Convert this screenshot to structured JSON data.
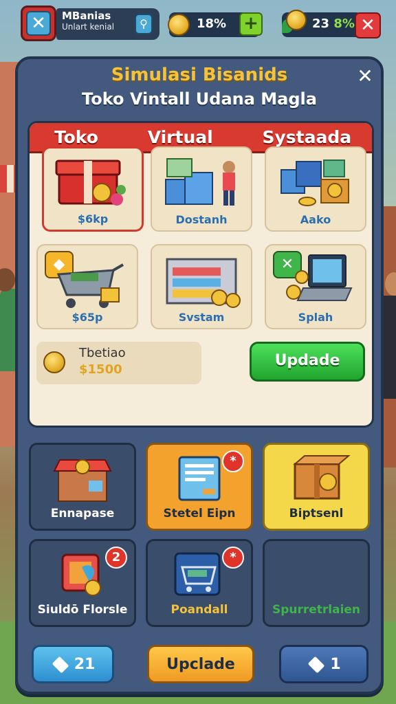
{
  "hud": {
    "profile_name": "MBanias",
    "profile_sub": "Unlart kenial",
    "coins": "18%",
    "gems_main": "23",
    "gems_accent": "8%",
    "icons": [
      "close-icon",
      "location-pin-icon",
      "coin-icon",
      "plus-icon",
      "coin-stack-icon",
      "close-icon"
    ]
  },
  "panel": {
    "title": "Simulasi Bisanids",
    "subtitle": "Toko Vintall Udana Magla",
    "tabs": [
      "Toko",
      "Virtual",
      "Systaada"
    ],
    "items": [
      {
        "label": "$6kp",
        "icon": "gift-box-icon"
      },
      {
        "label": "Dostanh",
        "icon": "shop-counter-icon"
      },
      {
        "label": "Aako",
        "icon": "crates-icon"
      },
      {
        "label": "$65p",
        "icon": "shopping-cart-icon"
      },
      {
        "label": "Svstam",
        "icon": "shelf-icon"
      },
      {
        "label": "Splah",
        "icon": "laptop-icon"
      }
    ],
    "balance_label": "Tbetiao",
    "balance_value": "$1500",
    "update_button": "Updade"
  },
  "tiles": [
    {
      "label": "Ennapase",
      "style": "dark",
      "icon": "store-icon"
    },
    {
      "label": "Stetel Eipn",
      "style": "orange",
      "icon": "card-icon",
      "notif": "*"
    },
    {
      "label": "Biptsenl",
      "style": "yellow",
      "icon": "package-icon"
    },
    {
      "label": "Siuldō Florsle",
      "style": "dark",
      "icon": "coin-device-icon",
      "notif": "2"
    },
    {
      "label": "Poandall",
      "style": "dark",
      "icon": "cart-icon",
      "notif": "*"
    },
    {
      "label": "Spurretrlaien",
      "style": "dark",
      "icon": ""
    }
  ],
  "bottom": {
    "left_value": "21",
    "center_label": "Upclade",
    "right_value": "1"
  },
  "colors": {
    "panel": "#435a7e",
    "tab_red": "#d93a30",
    "update_green": "#20a52e",
    "title_gold": "#f5c33b"
  }
}
